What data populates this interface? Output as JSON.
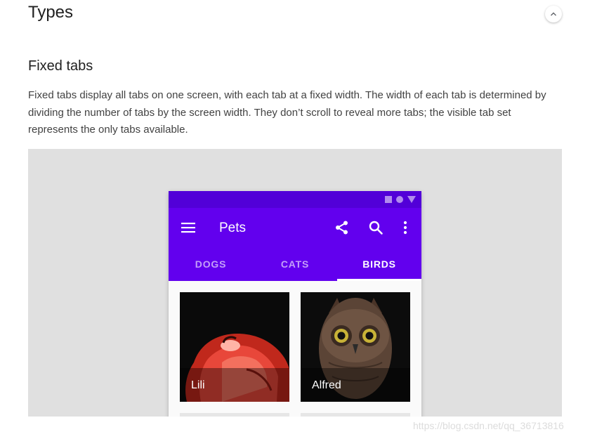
{
  "section": {
    "title": "Types"
  },
  "subsection": {
    "title": "Fixed tabs",
    "description": "Fixed tabs display all tabs on one screen, with each tab at a fixed width. The width of each tab is determined by dividing the number of tabs by the screen width. They don’t scroll to reveal more tabs; the visible tab set represents the only tabs available."
  },
  "icons": {
    "collapse": "chevron-up-icon",
    "menu": "hamburger-menu-icon",
    "share": "share-icon",
    "search": "search-icon",
    "more": "more-vert-icon",
    "status": [
      "square-status-icon",
      "circle-status-icon",
      "triangle-status-icon"
    ]
  },
  "phone": {
    "app_title": "Pets",
    "tabs": [
      {
        "label": "DOGS",
        "active": false
      },
      {
        "label": "CATS",
        "active": false
      },
      {
        "label": "BIRDS",
        "active": true
      }
    ],
    "cards": [
      {
        "label": "Lili",
        "image": "flamingo-photo"
      },
      {
        "label": "Alfred",
        "image": "owl-photo"
      }
    ]
  },
  "colors": {
    "primary": "#6200ee",
    "status_bar": "#5200d8",
    "panel_bg": "#e0e0e0"
  },
  "watermark": "https://blog.csdn.net/qq_36713816"
}
